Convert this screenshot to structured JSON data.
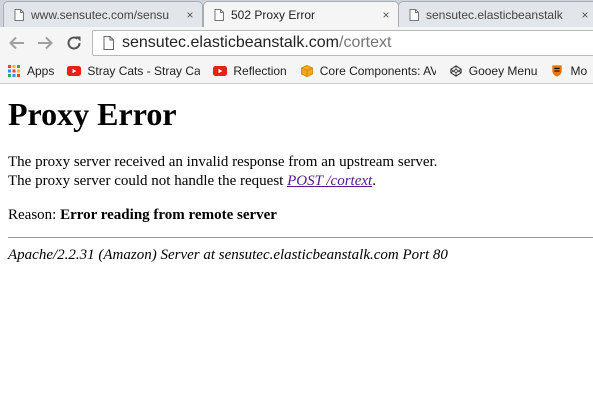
{
  "tabs": [
    {
      "title": "www.sensutec.com/sensu",
      "close": "×"
    },
    {
      "title": "502 Proxy Error",
      "close": "×"
    },
    {
      "title": "sensutec.elasticbeanstalk",
      "close": "×"
    }
  ],
  "toolbar": {
    "url_host": "sensutec.elasticbeanstalk.com",
    "url_path": "/cortext"
  },
  "bookmarks": [
    {
      "label": "Apps",
      "icon": "apps-grid-icon"
    },
    {
      "label": "Stray Cats - Stray Cat",
      "icon": "youtube-icon"
    },
    {
      "label": "Reflection",
      "icon": "youtube-icon"
    },
    {
      "label": "Core Components: AV",
      "icon": "package-icon"
    },
    {
      "label": "Gooey Menu",
      "icon": "codepen-icon"
    },
    {
      "label": "Mo",
      "icon": "princeton-shield-icon"
    }
  ],
  "page": {
    "heading": "Proxy Error",
    "line1": "The proxy server received an invalid response from an upstream server.",
    "line2_prefix": "The proxy server could not handle the request ",
    "line2_link": "POST /cortext",
    "line2_suffix": ".",
    "reason_label": "Reason: ",
    "reason_value": "Error reading from remote server",
    "address": "Apache/2.2.31 (Amazon) Server at sensutec.elasticbeanstalk.com Port 80"
  },
  "colors": {
    "link": "#551a8b",
    "youtube": "#e62117",
    "package": "#f5a623"
  }
}
